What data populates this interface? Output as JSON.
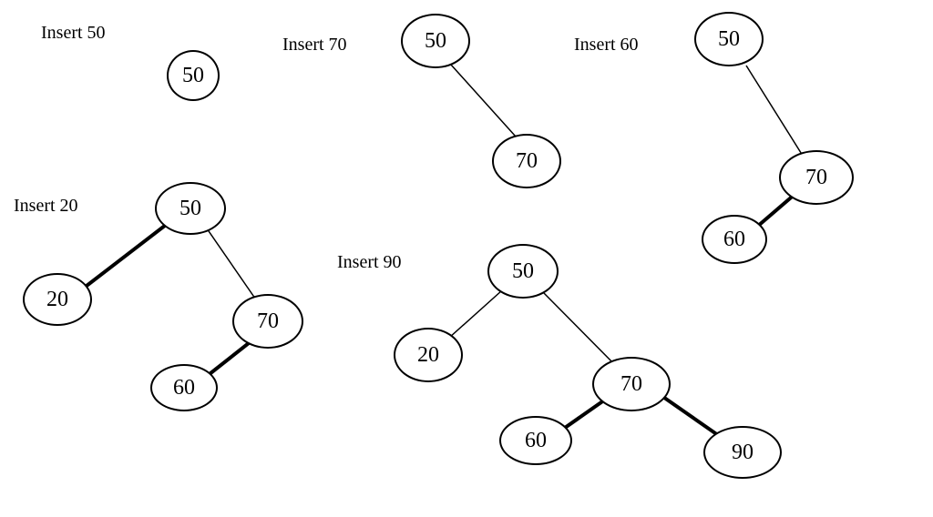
{
  "labels": {
    "insert50": "Insert 50",
    "insert70": "Insert 70",
    "insert60": "Insert 60",
    "insert20": "Insert 20",
    "insert90": "Insert 90"
  },
  "nodes": {
    "t1_50": "50",
    "t2_50": "50",
    "t2_70": "70",
    "t3_50": "50",
    "t3_70": "70",
    "t3_60": "60",
    "t4_50": "50",
    "t4_20": "20",
    "t4_70": "70",
    "t4_60": "60",
    "t5_50": "50",
    "t5_20": "20",
    "t5_70": "70",
    "t5_60": "60",
    "t5_90": "90"
  },
  "trees": [
    {
      "step": "Insert 50",
      "nodes": [
        50
      ]
    },
    {
      "step": "Insert 70",
      "nodes": [
        50,
        70
      ],
      "edges": [
        [
          50,
          70
        ]
      ]
    },
    {
      "step": "Insert 60",
      "nodes": [
        50,
        70,
        60
      ],
      "edges": [
        [
          50,
          70
        ],
        [
          70,
          60
        ]
      ]
    },
    {
      "step": "Insert 20",
      "nodes": [
        50,
        20,
        70,
        60
      ],
      "edges": [
        [
          50,
          20
        ],
        [
          50,
          70
        ],
        [
          70,
          60
        ]
      ]
    },
    {
      "step": "Insert 90",
      "nodes": [
        50,
        20,
        70,
        60,
        90
      ],
      "edges": [
        [
          50,
          20
        ],
        [
          50,
          70
        ],
        [
          70,
          60
        ],
        [
          70,
          90
        ]
      ]
    }
  ]
}
